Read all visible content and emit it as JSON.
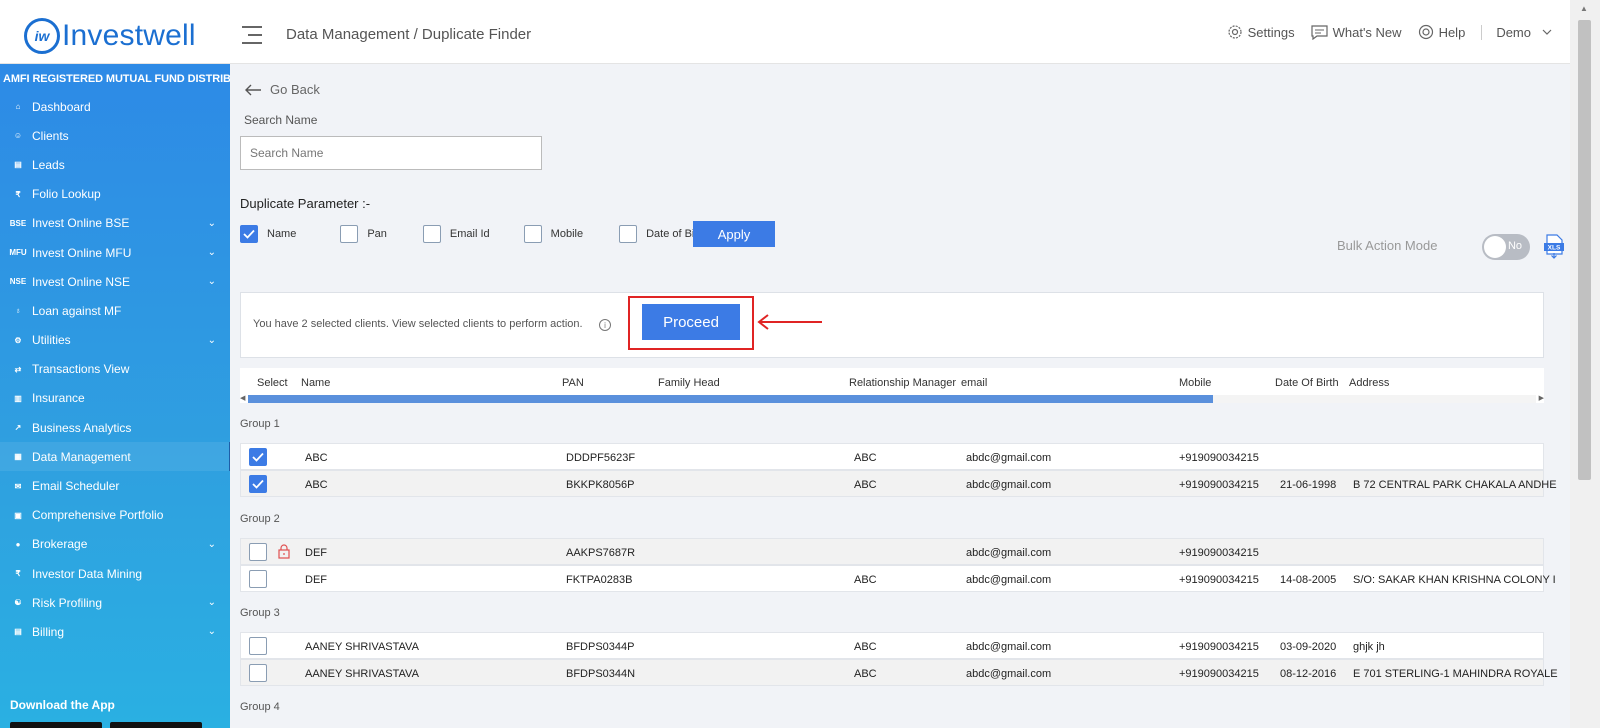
{
  "app": {
    "logo_mark": "iw",
    "logo_text": "Investwell",
    "breadcrumb": "Data Management / Duplicate Finder"
  },
  "header": {
    "settings": "Settings",
    "whats_new": "What's New",
    "help": "Help",
    "user": "Demo"
  },
  "sidebar": {
    "heading": "AMFI REGISTERED MUTUAL FUND DISTRIBUTOR",
    "items": [
      {
        "label": "Dashboard",
        "icon": "home-icon",
        "glyph": "⌂",
        "chevron": false
      },
      {
        "label": "Clients",
        "icon": "users-icon",
        "glyph": "☺",
        "chevron": false
      },
      {
        "label": "Leads",
        "icon": "leads-icon",
        "glyph": "▤",
        "chevron": false
      },
      {
        "label": "Folio Lookup",
        "icon": "folio-icon",
        "glyph": "₹",
        "chevron": false
      },
      {
        "label": "Invest Online BSE",
        "icon": "bse-icon",
        "glyph": "BSE",
        "chevron": true
      },
      {
        "label": "Invest Online MFU",
        "icon": "mfu-icon",
        "glyph": "MFU",
        "chevron": true
      },
      {
        "label": "Invest Online NSE",
        "icon": "nse-icon",
        "glyph": "NSE",
        "chevron": true
      },
      {
        "label": "Loan against MF",
        "icon": "loan-icon",
        "glyph": "♁",
        "chevron": false
      },
      {
        "label": "Utilities",
        "icon": "utilities-icon",
        "glyph": "⚙",
        "chevron": true
      },
      {
        "label": "Transactions View",
        "icon": "transactions-icon",
        "glyph": "⇄",
        "chevron": false
      },
      {
        "label": "Insurance",
        "icon": "insurance-icon",
        "glyph": "▥",
        "chevron": false
      },
      {
        "label": "Business Analytics",
        "icon": "analytics-icon",
        "glyph": "↗",
        "chevron": false
      },
      {
        "label": "Data Management",
        "icon": "data-icon",
        "glyph": "▦",
        "chevron": false
      },
      {
        "label": "Email Scheduler",
        "icon": "email-icon",
        "glyph": "✉",
        "chevron": false
      },
      {
        "label": "Comprehensive Portfolio",
        "icon": "portfolio-icon",
        "glyph": "▣",
        "chevron": false
      },
      {
        "label": "Brokerage",
        "icon": "brokerage-icon",
        "glyph": "●",
        "chevron": true
      },
      {
        "label": "Investor Data Mining",
        "icon": "mining-icon",
        "glyph": "₹",
        "chevron": false
      },
      {
        "label": "Risk Profiling",
        "icon": "risk-icon",
        "glyph": "☯",
        "chevron": true
      },
      {
        "label": "Billing",
        "icon": "billing-icon",
        "glyph": "▤",
        "chevron": true
      }
    ],
    "active_index": 12,
    "download": "Download the App"
  },
  "main": {
    "go_back": "Go Back",
    "search_label": "Search Name",
    "search_placeholder": "Search Name",
    "search_value": "",
    "duplicate_param_label": "Duplicate Parameter :-",
    "params": [
      {
        "label": "Name",
        "checked": true
      },
      {
        "label": "Pan",
        "checked": false
      },
      {
        "label": "Email Id",
        "checked": false
      },
      {
        "label": "Mobile",
        "checked": false
      },
      {
        "label": "Date of Birth",
        "checked": false
      }
    ],
    "apply": "Apply",
    "bulk_action": "Bulk Action Mode",
    "bulk_toggle": "No",
    "xls_icon": "xls-download-icon",
    "panel_message": "You have 2 selected clients. View selected clients to perform action.",
    "info_glyph": "i",
    "proceed": "Proceed",
    "highlight_color": "#e02424",
    "accent_color": "#3c7be5"
  },
  "table": {
    "columns": [
      "Select",
      "Name",
      "PAN",
      "Family Head",
      "Relationship Manager",
      "email",
      "Mobile",
      "Date Of Birth",
      "Address"
    ],
    "groups": [
      {
        "title": "Group 1",
        "rows": [
          {
            "checked": true,
            "locked": false,
            "name": "ABC",
            "pan": "DDDPF5623F",
            "family_head": "",
            "rm": "ABC",
            "email": "abdc@gmail.com",
            "mobile": "+919090034215",
            "dob": "",
            "address": ""
          },
          {
            "checked": true,
            "locked": false,
            "name": "ABC",
            "pan": "BKKPK8056P",
            "family_head": "",
            "rm": "ABC",
            "email": "abdc@gmail.com",
            "mobile": "+919090034215",
            "dob": "21-06-1998",
            "address": "B 72 CENTRAL PARK CHAKALA ANDHE"
          }
        ]
      },
      {
        "title": "Group 2",
        "rows": [
          {
            "checked": false,
            "locked": true,
            "name": "DEF",
            "pan": "AAKPS7687R",
            "family_head": "",
            "rm": "",
            "email": "abdc@gmail.com",
            "mobile": "+919090034215",
            "dob": "",
            "address": ""
          },
          {
            "checked": false,
            "locked": false,
            "name": "DEF",
            "pan": "FKTPA0283B",
            "family_head": "",
            "rm": "ABC",
            "email": "abdc@gmail.com",
            "mobile": "+919090034215",
            "dob": "14-08-2005",
            "address": "S/O: SAKAR KHAN KRISHNA COLONY I"
          }
        ]
      },
      {
        "title": "Group 3",
        "rows": [
          {
            "checked": false,
            "locked": false,
            "name": "AANEY SHRIVASTAVA",
            "pan": "BFDPS0344P",
            "family_head": "",
            "rm": "ABC",
            "email": "abdc@gmail.com",
            "mobile": "+919090034215",
            "dob": "03-09-2020",
            "address": "ghjk jh"
          },
          {
            "checked": false,
            "locked": false,
            "name": "AANEY SHRIVASTAVA",
            "pan": "BFDPS0344N",
            "family_head": "",
            "rm": "ABC",
            "email": "abdc@gmail.com",
            "mobile": "+919090034215",
            "dob": "08-12-2016",
            "address": "E 701 STERLING-1 MAHINDRA ROYALE"
          }
        ]
      },
      {
        "title": "Group 4",
        "rows": []
      }
    ]
  }
}
